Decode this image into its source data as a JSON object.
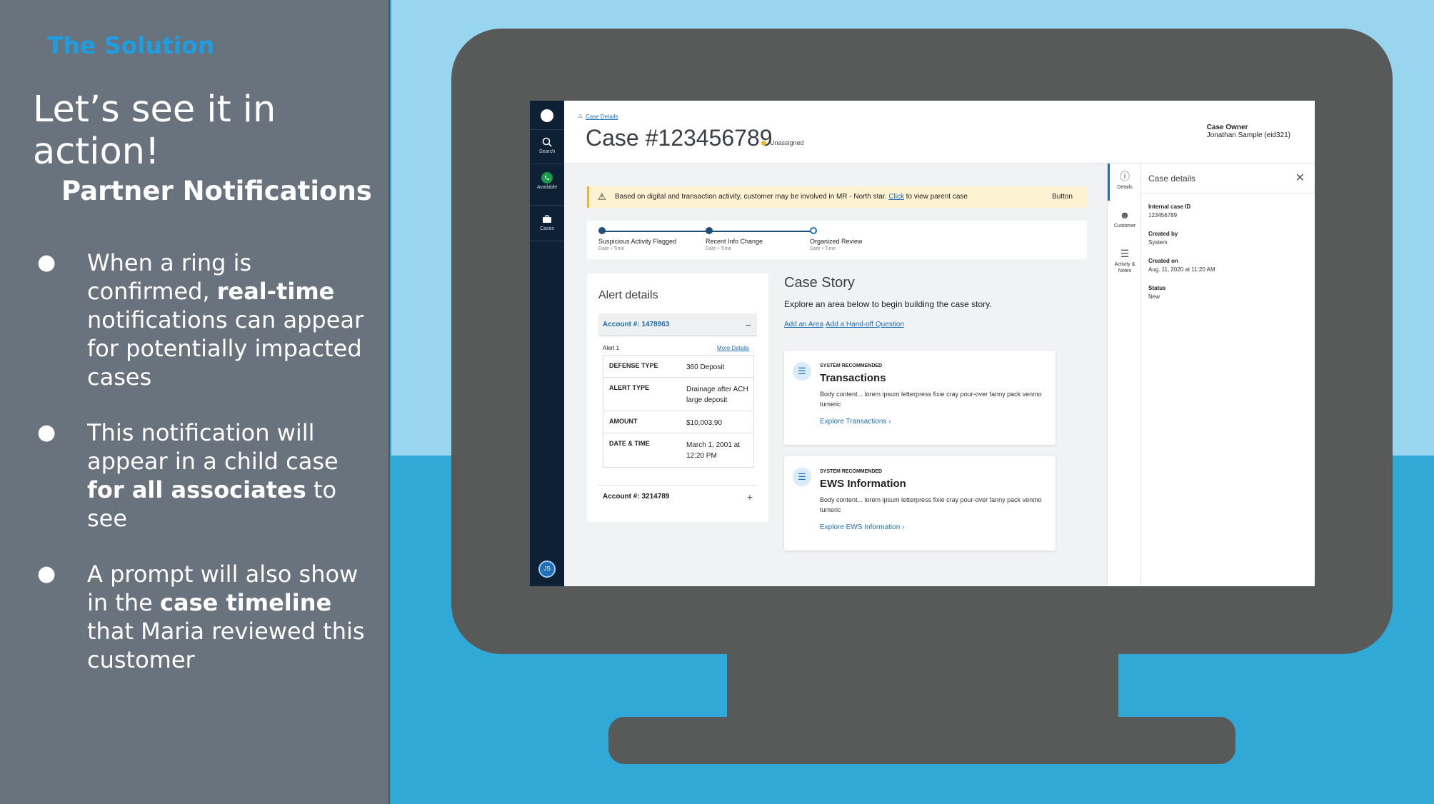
{
  "slide": {
    "section": "The Solution",
    "title": "Let’s see it in action!",
    "subtitle": "Partner Notifications",
    "bullets": [
      {
        "pre": "When a ring is confirmed, ",
        "bold": "real-time",
        "post": " notifications can appear for potentially impacted cases"
      },
      {
        "pre": "This notification will appear in a child case ",
        "bold": "for all associates",
        "post": " to see"
      },
      {
        "pre": "A prompt will also show in the ",
        "bold": "case timeline",
        "post": " that Maria reviewed this customer"
      }
    ],
    "bullet_glyph": "●"
  },
  "colors": {
    "accent": "#1e9ee0",
    "panel": "#68737e",
    "sky": "#98d5ef",
    "sea": "#30a9d6",
    "monitor": "#585959",
    "nav": "#0d2034",
    "link": "#1f6fb8",
    "warning_bg": "#fdf2d2"
  },
  "app": {
    "nav": [
      {
        "icon": "search-icon",
        "label": "Search"
      },
      {
        "icon": "phone-icon",
        "label": "Available"
      },
      {
        "icon": "briefcase-icon",
        "label": "Cases"
      }
    ],
    "avatar": "JS",
    "breadcrumb": "Case Details",
    "case_title": "Case #123456789",
    "status": "Unassigned",
    "owner_label": "Case Owner",
    "owner_name": "Jonathan Sample (eid321)",
    "banner": {
      "message": "Based on digital and transaction activity, customer may be involved in MR - North star.",
      "link": "Click",
      "after_link": "to view parent case",
      "button": "Button"
    },
    "timeline": [
      {
        "label": "Suspicious Activity Flagged",
        "sub": "Date • Time"
      },
      {
        "label": "Recent Info Change",
        "sub": "Date • Time"
      },
      {
        "label": "Organized Review",
        "sub": "Date • Time"
      }
    ],
    "alert_details": {
      "title": "Alert details",
      "account1": "Account #: 1478963",
      "collapse_icon": "−",
      "alert_label": "Alert 1",
      "more_details": "More Details",
      "fields": [
        {
          "key": "DEFENSE TYPE",
          "value": "360 Deposit"
        },
        {
          "key": "ALERT TYPE",
          "value": "Drainage after ACH large deposit"
        },
        {
          "key": "AMOUNT",
          "value": "$10,003.90"
        },
        {
          "key": "DATE & TIME",
          "value": "March 1, 2001 at 12:20 PM"
        }
      ],
      "account2": "Account #: 3214789",
      "expand_icon": "+"
    },
    "case_story": {
      "title": "Case Story",
      "subtitle": "Explore an area below to begin building the case story.",
      "links": [
        "Add an Area",
        "Add a Hand-off Question"
      ],
      "cards": [
        {
          "tag": "SYSTEM RECOMMENDED",
          "title": "Transactions",
          "body": "Body content... lorem ipsum letterpress fixie cray pour-over fanny pack venmo tumeric",
          "link": "Explore Transactions ›"
        },
        {
          "tag": "SYSTEM RECOMMENDED",
          "title": "EWS Information",
          "body": "Body content... lorem ipsum letterpress fixie cray pour-over fanny pack venmo tumeric",
          "link": "Explore EWS Information ›"
        }
      ]
    },
    "rail": [
      {
        "icon": "info-icon",
        "label": "Details"
      },
      {
        "icon": "user-icon",
        "label": "Customer"
      },
      {
        "icon": "list-icon",
        "label": "Activity & Notes"
      }
    ],
    "panel": {
      "title": "Case details",
      "close": "✕",
      "fields": [
        {
          "key": "Internal case ID",
          "value": "123456789"
        },
        {
          "key": "Created by",
          "value": "System"
        },
        {
          "key": "Created on",
          "value": "Aug. 11, 2020 at 11:20 AM"
        },
        {
          "key": "Status",
          "value": "New"
        }
      ]
    }
  }
}
